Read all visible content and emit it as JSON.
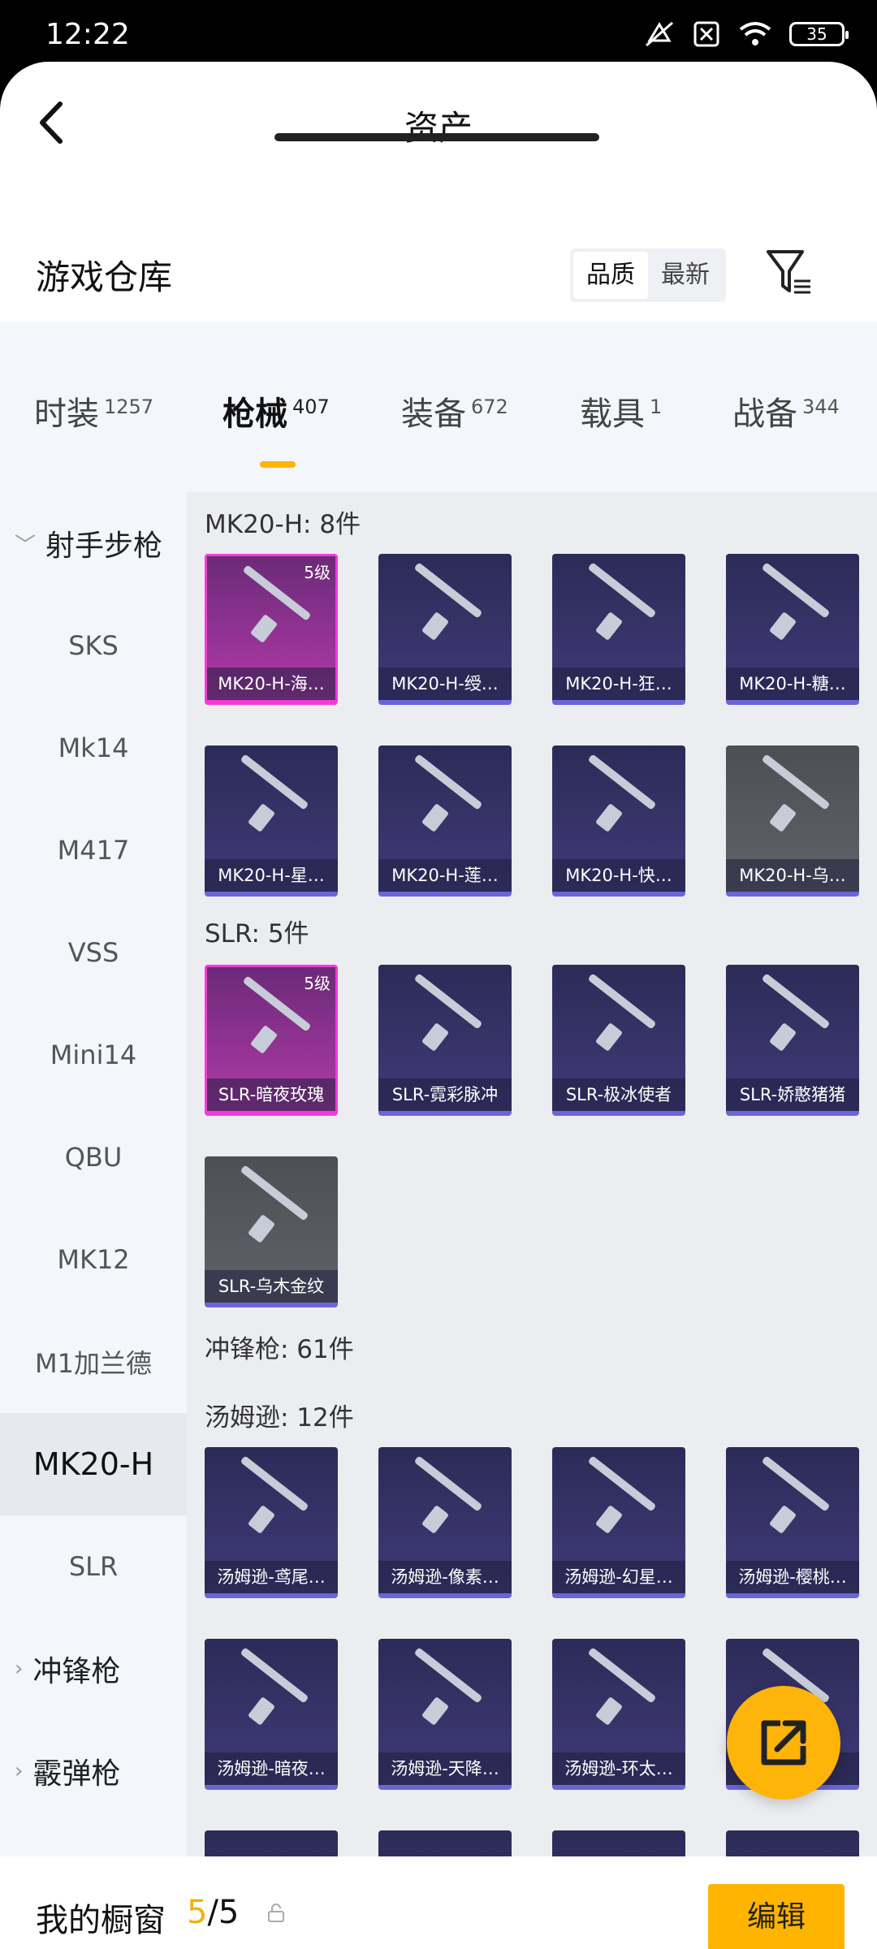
{
  "status": {
    "time": "12:22",
    "battery": "35"
  },
  "header": {
    "title": "资产"
  },
  "section": {
    "title": "游戏仓库",
    "sort_options": [
      "品质",
      "最新"
    ]
  },
  "tabs": [
    {
      "label": "时装",
      "count": "1257"
    },
    {
      "label": "枪械",
      "count": "407"
    },
    {
      "label": "装备",
      "count": "672"
    },
    {
      "label": "载具",
      "count": "1"
    },
    {
      "label": "战备",
      "count": "344"
    }
  ],
  "sidebar": {
    "group_sniper": "射手步枪",
    "items": [
      "SKS",
      "Mk14",
      "M417",
      "VSS",
      "Mini14",
      "QBU",
      "MK12",
      "M1加兰德",
      "MK20-H",
      "SLR"
    ],
    "group_smg": "冲锋枪",
    "group_shotgun": "霰弹枪"
  },
  "groups": {
    "mk20": {
      "label": "MK20-H: 8件"
    },
    "slr": {
      "label": "SLR: 5件"
    },
    "smg": {
      "label": "冲锋枪: 61件"
    },
    "thompson": {
      "label": "汤姆逊: 12件"
    }
  },
  "cards": [
    {
      "name": "MK20-H-海…",
      "level": "5级"
    },
    {
      "name": "MK20-H-绶…"
    },
    {
      "name": "MK20-H-狂…"
    },
    {
      "name": "MK20-H-糖…"
    },
    {
      "name": "MK20-H-星…"
    },
    {
      "name": "MK20-H-莲…"
    },
    {
      "name": "MK20-H-快…"
    },
    {
      "name": "MK20-H-乌…"
    },
    {
      "name": "SLR-暗夜玫瑰",
      "level": "5级"
    },
    {
      "name": "SLR-霓彩脉冲"
    },
    {
      "name": "SLR-极冰使者"
    },
    {
      "name": "SLR-娇憨猪猪"
    },
    {
      "name": "SLR-乌木金纹"
    },
    {
      "name": "汤姆逊-鸢尾…"
    },
    {
      "name": "汤姆逊-像素…"
    },
    {
      "name": "汤姆逊-幻星…"
    },
    {
      "name": "汤姆逊-樱桃…"
    },
    {
      "name": "汤姆逊-暗夜…"
    },
    {
      "name": "汤姆逊-天降…"
    },
    {
      "name": "汤姆逊-环太…"
    },
    {
      "name": "…"
    }
  ],
  "bottom": {
    "showcase_label": "我的橱窗",
    "current": "5",
    "total": "/5",
    "edit_label": "编辑"
  },
  "colors": {
    "accent": "#ffb400",
    "legend": "#f23bd8",
    "rare": "#6a66d6"
  }
}
